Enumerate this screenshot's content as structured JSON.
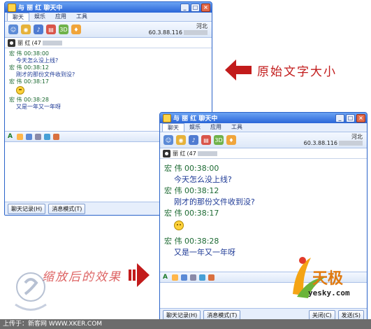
{
  "app": {
    "title": "与 丽 红 聊天中"
  },
  "tabs": [
    {
      "label": "聊天"
    },
    {
      "label": "娱乐"
    },
    {
      "label": "应用"
    },
    {
      "label": "工具"
    }
  ],
  "peer": {
    "location": "河北",
    "ip": "60.3.88.116"
  },
  "contact": {
    "name": "丽 红",
    "id_prefix": "(47"
  },
  "messages": [
    {
      "sender": "宏 伟",
      "time": "00:38:00",
      "text": "今天怎么没上线?"
    },
    {
      "sender": "宏 伟",
      "time": "00:38:12",
      "text": "刚才的那份文件收到没?"
    },
    {
      "sender": "宏 伟",
      "time": "00:38:17",
      "text": ""
    },
    {
      "sender": "宏 伟",
      "time": "00:38:28",
      "text": "又是一年又一年呀"
    }
  ],
  "buttons": {
    "history": "聊天记录(H)",
    "mode": "消息模式(T)",
    "close": "关闭(C)",
    "send": "发送(S)"
  },
  "annotations": {
    "original": "原始文字大小",
    "scaled": "缩放后的效果"
  },
  "watermarks": {
    "yesky_cn": "天极",
    "yesky_en": "yesky.com"
  },
  "caption": "上传于：新客网 WWW.XKER.COM"
}
